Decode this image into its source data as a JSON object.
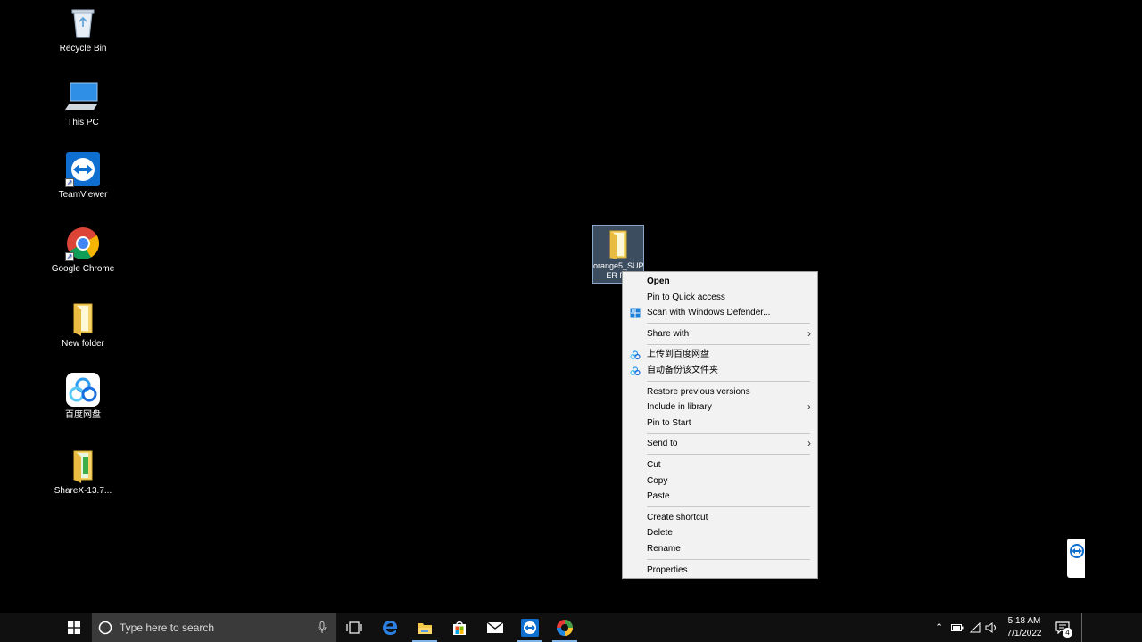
{
  "desktop": {
    "icons": [
      {
        "label": "Recycle Bin",
        "icon": "recycle-bin-icon"
      },
      {
        "label": "This PC",
        "icon": "computer-icon"
      },
      {
        "label": "TeamViewer",
        "icon": "teamviewer-icon"
      },
      {
        "label": "Google Chrome",
        "icon": "chrome-icon"
      },
      {
        "label": "New folder",
        "icon": "folder-icon"
      },
      {
        "label": "百度网盘",
        "icon": "baidu-netdisk-icon"
      },
      {
        "label": "ShareX-13.7...",
        "icon": "folder-icon"
      }
    ],
    "selected_item": {
      "label_line1": "orange5_SUP",
      "label_line2": "ER P..."
    }
  },
  "context_menu": {
    "items": [
      {
        "label": "Open"
      },
      {
        "label": "Pin to Quick access"
      },
      {
        "label": "Scan with Windows Defender..."
      },
      {
        "label": "Share with"
      },
      {
        "label": "上传到百度网盘"
      },
      {
        "label": "自动备份该文件夹"
      },
      {
        "label": "Restore previous versions"
      },
      {
        "label": "Include in library"
      },
      {
        "label": "Pin to Start"
      },
      {
        "label": "Send to"
      },
      {
        "label": "Cut"
      },
      {
        "label": "Copy"
      },
      {
        "label": "Paste"
      },
      {
        "label": "Create shortcut"
      },
      {
        "label": "Delete"
      },
      {
        "label": "Rename"
      },
      {
        "label": "Properties"
      }
    ]
  },
  "taskbar": {
    "search_placeholder": "Type here to search",
    "pinned": [
      "task-view-icon",
      "edge-icon",
      "file-explorer-icon",
      "store-icon",
      "mail-icon",
      "teamviewer-icon",
      "sharex-icon"
    ],
    "clock_time": "5:18 AM",
    "clock_date": "7/1/2022",
    "notification_count": "4"
  },
  "colors": {
    "accent": "#1a73e8",
    "desktop_bg": "#000000",
    "menu_bg": "#f2f2f2",
    "taskbar_bg": "#101010"
  }
}
